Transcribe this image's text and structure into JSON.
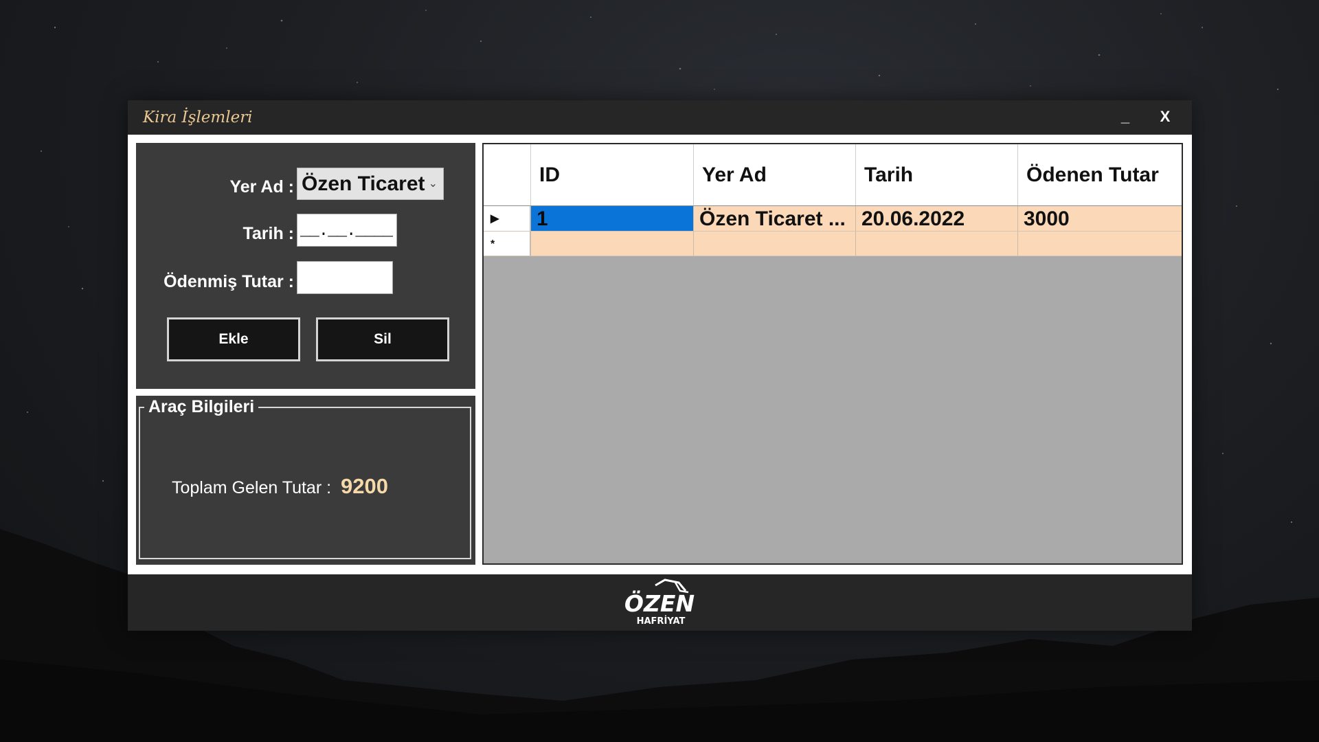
{
  "window": {
    "title": "Kira İşlemleri",
    "minimize_label": "_",
    "close_label": "X"
  },
  "form": {
    "yer_ad_label": "Yer Ad :",
    "yer_ad_value": "Özen Ticaret",
    "tarih_label": "Tarih :",
    "tarih_mask": "__.__.____",
    "tutar_label": "Ödenmiş Tutar :",
    "tutar_value": "",
    "ekle_label": "Ekle",
    "sil_label": "Sil"
  },
  "group": {
    "title": "Araç Bilgileri",
    "total_label": "Toplam Gelen Tutar :",
    "total_value": "9200"
  },
  "grid": {
    "columns": [
      "ID",
      "Yer Ad",
      "Tarih",
      "Ödenen Tutar"
    ],
    "rows": [
      {
        "marker": "▶",
        "id": "1",
        "yer_ad": "Özen Ticaret ...",
        "tarih": "20.06.2022",
        "tutar": "3000"
      }
    ],
    "new_row_marker": "*"
  },
  "footer": {
    "logo_text": "ÖZEN",
    "logo_subtext": "HAFRİYAT"
  },
  "colors": {
    "titlebar": "#262626",
    "title_text": "#e8c793",
    "panel": "#3b3b3b",
    "row_bg": "#fbd8b7",
    "selection": "#0b74d9",
    "grid_empty": "#aaaaaa"
  }
}
